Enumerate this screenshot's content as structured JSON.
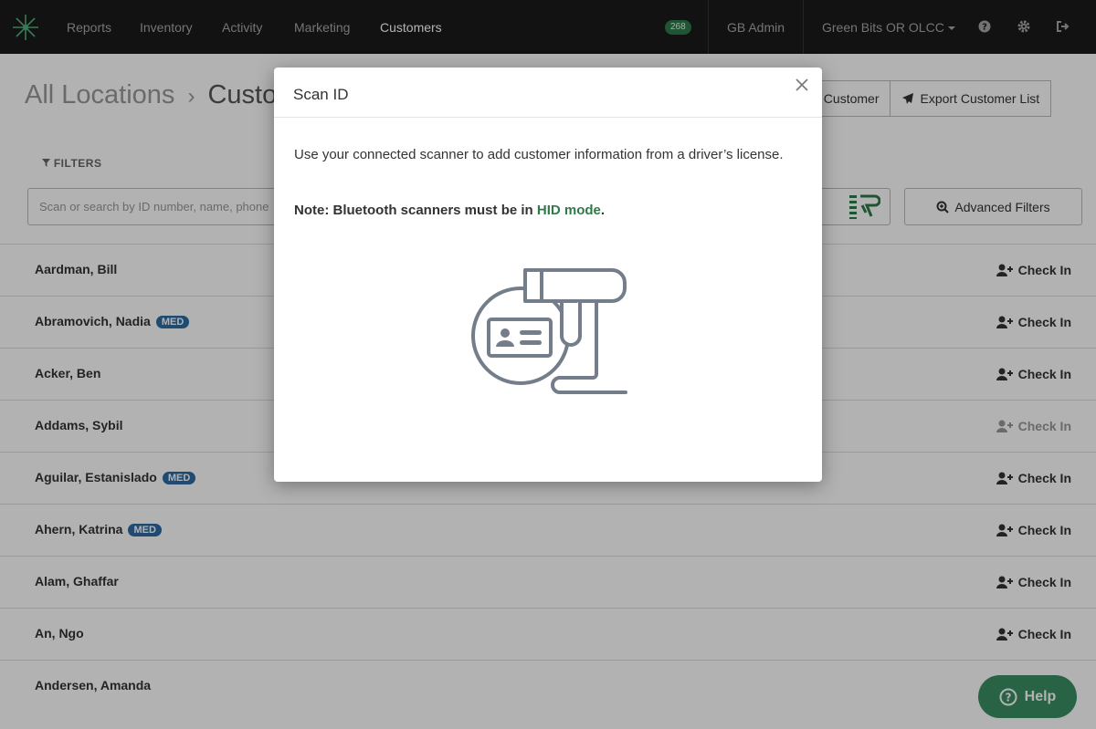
{
  "nav": {
    "items": [
      "Reports",
      "Inventory",
      "Activity",
      "Marketing",
      "Customers"
    ],
    "active": "Customers",
    "badge": "268",
    "user": "GB Admin",
    "org": "Green Bits OR OLCC"
  },
  "page": {
    "breadcrumb_root": "All Locations",
    "breadcrumb_current": "Customers",
    "add_customer_label": "Add Customer",
    "export_label": "Export Customer List",
    "filters_label": "FILTERS",
    "search_placeholder": "Scan or search by ID number, name, phone",
    "advanced_filters_label": "Advanced Filters"
  },
  "customers": [
    {
      "name": "Aardman, Bill",
      "med": ""
    },
    {
      "name": "Abramovich, Nadia",
      "med": "MED"
    },
    {
      "name": "Acker, Ben",
      "med": ""
    },
    {
      "name": "Addams, Sybil",
      "med": ""
    },
    {
      "name": "Aguilar, Estanislado",
      "med": "MED"
    },
    {
      "name": "Ahern, Katrina",
      "med": "MED"
    },
    {
      "name": "Alam, Ghaffar",
      "med": ""
    },
    {
      "name": "An, Ngo",
      "med": ""
    },
    {
      "name": "Andersen, Amanda",
      "med": ""
    }
  ],
  "checkin_label": "Check In",
  "help_label": "Help",
  "modal": {
    "title": "Scan ID",
    "text": "Use your connected scanner to add customer information from a driver’s license.",
    "note_prefix": "Note: Bluetooth scanners must be in",
    "note_link": "HID mode",
    "note_suffix": "."
  },
  "colors": {
    "nav_bg": "#1b1b1b",
    "accent_green": "#2f7a49",
    "med_badge": "#2d6aa3",
    "help_button": "#3a8f63"
  }
}
